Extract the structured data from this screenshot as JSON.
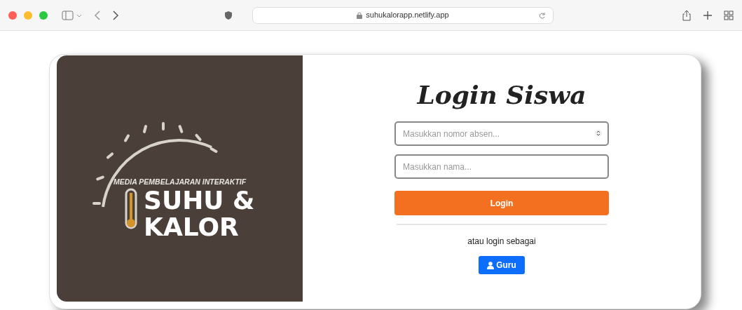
{
  "browser": {
    "address": "suhukalorapp.netlify.app"
  },
  "logo": {
    "tagline": "MEDIA PEMBELAJARAN INTERAKTIF",
    "title_lines": [
      "SUHU &",
      "KALOR"
    ]
  },
  "form": {
    "title": "Login Siswa",
    "fields": [
      {
        "kind": "number",
        "placeholder": "Masukkan nomor absen..."
      },
      {
        "kind": "text",
        "placeholder": "Masukkan nama..."
      }
    ],
    "submit": "Login",
    "alt_text": "atau login sebagai",
    "alt_button": "Guru"
  }
}
